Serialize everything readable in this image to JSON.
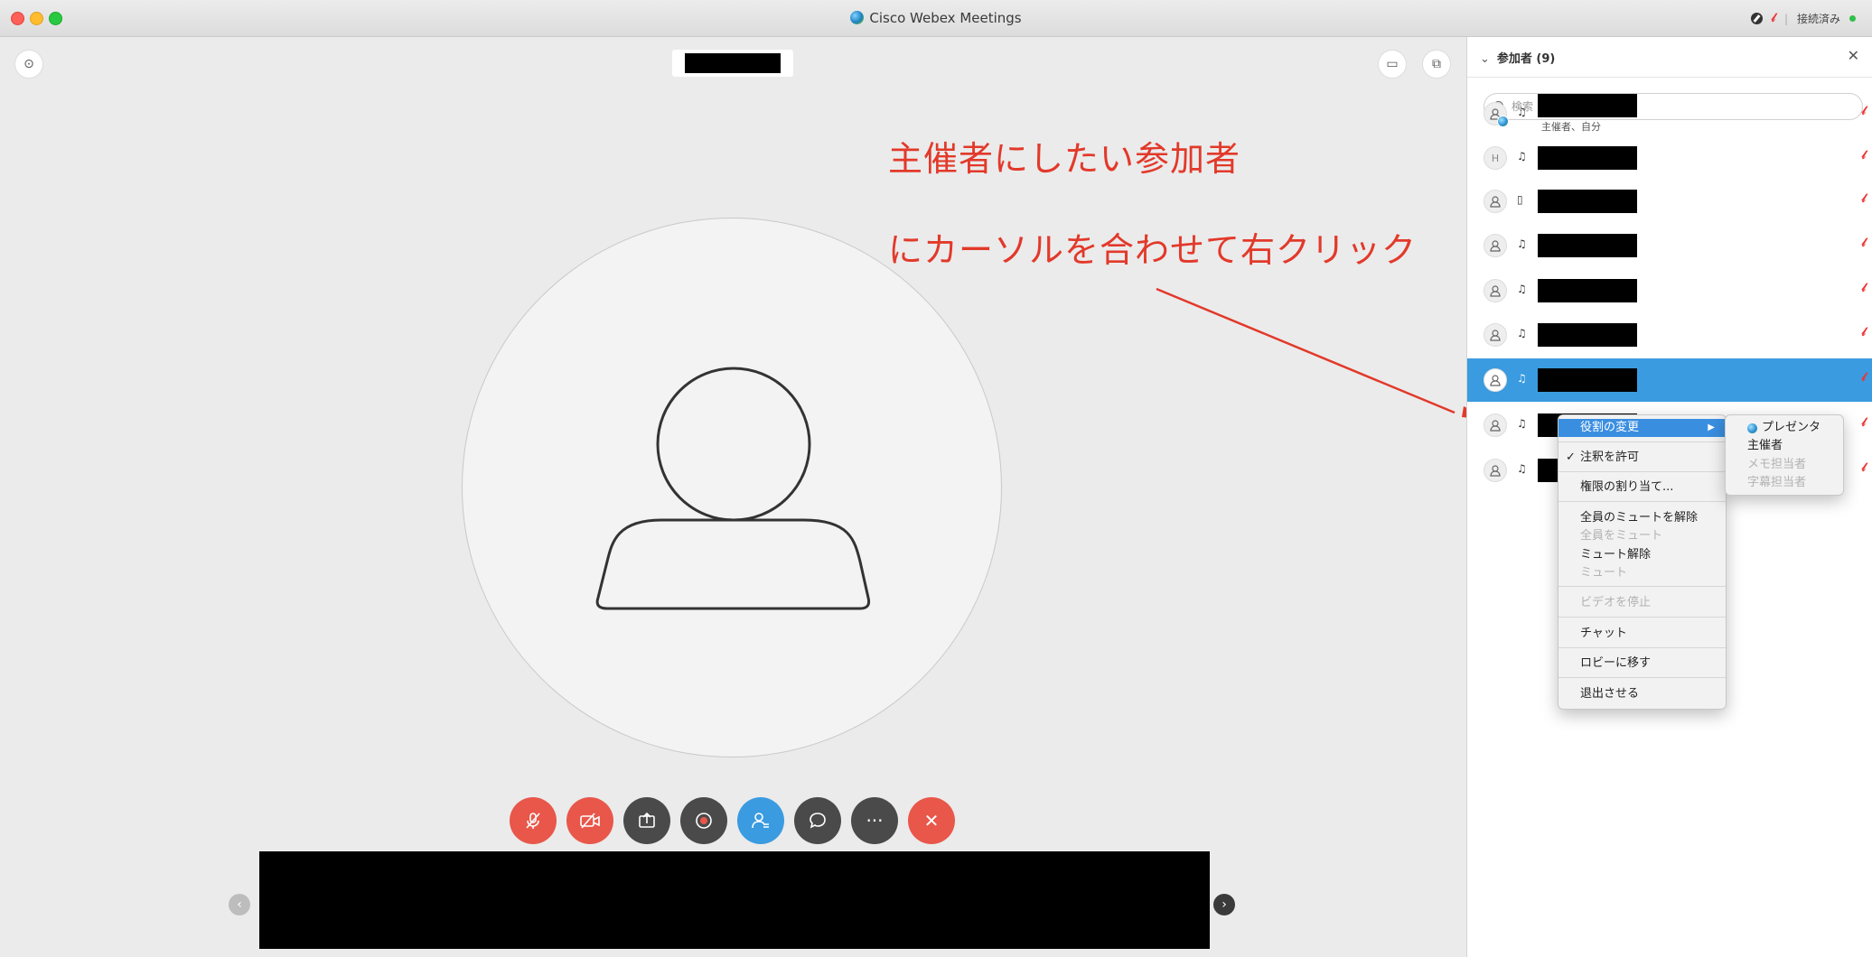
{
  "window": {
    "title": "Cisco Webex Meetings",
    "status": "接続済み"
  },
  "annotation": {
    "line1": "主催者にしたい参加者",
    "line2": "にカーソルを合わせて右クリック",
    "color": "#e2392a"
  },
  "controls": {
    "buttons": [
      {
        "name": "mute",
        "icon": "mic-off-icon",
        "color": "#e8574a"
      },
      {
        "name": "video",
        "icon": "video-off-icon",
        "color": "#e8574a"
      },
      {
        "name": "share",
        "icon": "share-icon",
        "color": "#4a4a4a"
      },
      {
        "name": "record",
        "icon": "record-icon",
        "color": "#4a4a4a"
      },
      {
        "name": "participants",
        "icon": "participants-icon",
        "color": "#3a9be0"
      },
      {
        "name": "chat",
        "icon": "chat-icon",
        "color": "#4a4a4a"
      },
      {
        "name": "more",
        "icon": "more-icon",
        "color": "#4a4a4a"
      },
      {
        "name": "leave",
        "icon": "close-icon",
        "color": "#e8574a"
      }
    ],
    "more_label": "···",
    "leave_label": "✕"
  },
  "panel": {
    "header": "参加者 (9)",
    "search_placeholder": "検索",
    "participants": [
      {
        "avatar": "person",
        "device": "headset",
        "sub": "主催者、自分",
        "presenter": true
      },
      {
        "avatar": "H",
        "device": "headset",
        "sub": ""
      },
      {
        "avatar": "person",
        "device": "phone",
        "sub": ""
      },
      {
        "avatar": "person",
        "device": "headset",
        "sub": ""
      },
      {
        "avatar": "person",
        "device": "headset",
        "sub": ""
      },
      {
        "avatar": "person",
        "device": "headset",
        "sub": ""
      },
      {
        "avatar": "person",
        "device": "headset",
        "sub": "",
        "selected": true
      },
      {
        "avatar": "person",
        "device": "headset",
        "sub": ""
      },
      {
        "avatar": "person",
        "device": "headset",
        "sub": ""
      }
    ]
  },
  "context_menu": {
    "items": [
      {
        "label": "役割の変更",
        "state": "active",
        "submenu": true
      },
      {
        "label": "注釈を許可",
        "state": "checked"
      },
      {
        "label": "権限の割り当て...",
        "state": "normal"
      },
      {
        "label": "全員のミュートを解除",
        "state": "normal"
      },
      {
        "label": "全員をミュート",
        "state": "disabled"
      },
      {
        "label": "ミュート解除",
        "state": "normal"
      },
      {
        "label": "ミュート",
        "state": "disabled"
      },
      {
        "label": "ビデオを停止",
        "state": "disabled"
      },
      {
        "label": "チャット",
        "state": "normal"
      },
      {
        "label": "ロビーに移す",
        "state": "normal"
      },
      {
        "label": "退出させる",
        "state": "normal"
      }
    ]
  },
  "role_submenu": {
    "items": [
      {
        "label": "プレゼンタ",
        "state": "normal",
        "icon": "presenter-icon"
      },
      {
        "label": "主催者",
        "state": "normal"
      },
      {
        "label": "メモ担当者",
        "state": "disabled"
      },
      {
        "label": "字幕担当者",
        "state": "disabled"
      }
    ]
  }
}
